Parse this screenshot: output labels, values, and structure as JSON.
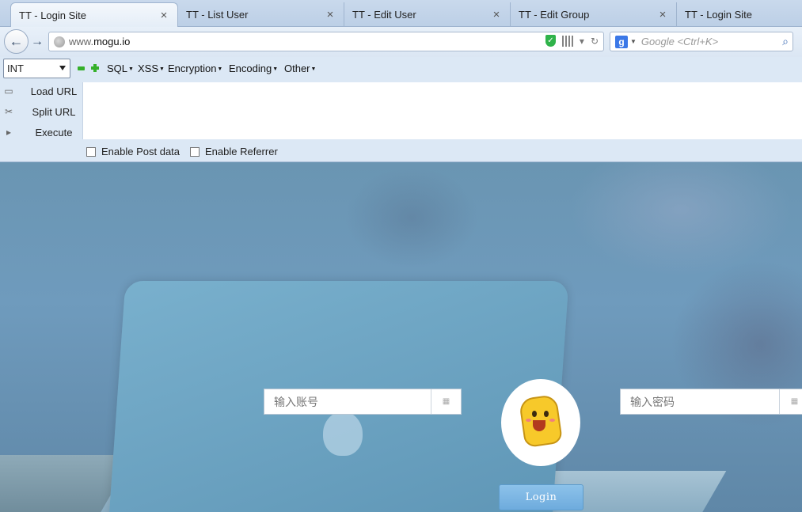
{
  "tabs": [
    {
      "title": "TT - Login Site",
      "active": true
    },
    {
      "title": "TT - List User",
      "active": false
    },
    {
      "title": "TT - Edit User",
      "active": false
    },
    {
      "title": "TT - Edit Group",
      "active": false
    },
    {
      "title": "TT - Login Site",
      "active": false
    }
  ],
  "tab_close": "×",
  "nav": {
    "back": "←",
    "forward": "→",
    "url_prefix": "www.",
    "url_domain": "mogu.io",
    "reload": "↻",
    "search_engine": "g",
    "search_placeholder": "Google <Ctrl+K>",
    "search_icon": "⌕"
  },
  "hackbar": {
    "select_value": "INT",
    "menus": [
      "SQL",
      "XSS",
      "Encryption",
      "Encoding",
      "Other"
    ],
    "actions": [
      "Load URL",
      "Split URL",
      "Execute"
    ],
    "checkboxes": [
      "Enable Post data",
      "Enable Referrer"
    ]
  },
  "login": {
    "username_placeholder": "输入账号",
    "password_placeholder": "输入密码",
    "login_label": "Login"
  },
  "colors": {
    "accent": "#6eabdd",
    "hackbar_bg": "#dce8f5",
    "tabstrip_bg": "#c9d9ec"
  }
}
